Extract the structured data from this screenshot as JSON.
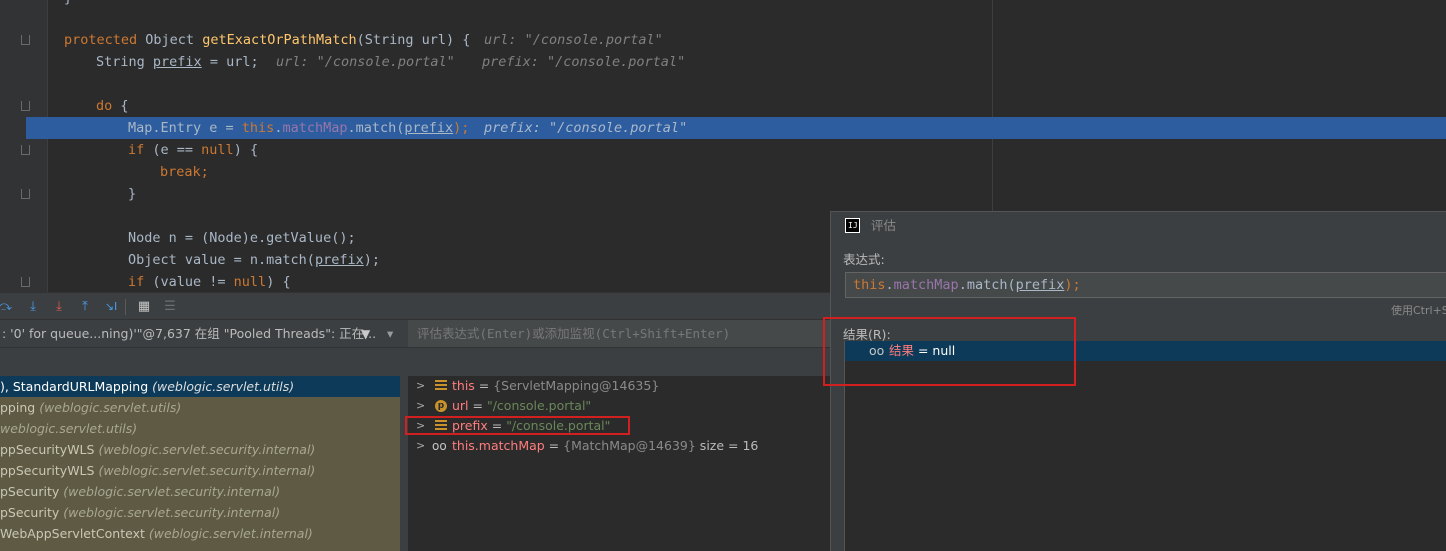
{
  "editor": {
    "line0": "}",
    "method_kw": "protected",
    "method_rest": " Object ",
    "method_name": "getExactOrPathMatch",
    "method_params": "(String url) {",
    "method_hint": "url: \"/console.portal\"",
    "prefix_type": "String ",
    "prefix_var": "prefix",
    "prefix_assign": " = url;",
    "prefix_hint1": "url: \"/console.portal\"",
    "prefix_hint2": "prefix: \"/console.portal\"",
    "do_kw": "do",
    "do_brace": " {",
    "exec_a": "Map.Entry e = ",
    "exec_this": "this",
    "exec_dot": ".",
    "exec_field": "matchMap",
    "exec_call": ".match(",
    "exec_arg": "prefix",
    "exec_end": ");",
    "exec_hint": "prefix: \"/console.portal\"",
    "if_kw": "if",
    "if_mid": " (e == ",
    "if_null": "null",
    "if_end": ") {",
    "break_kw": "break;",
    "close_brace": "}",
    "node_line": "Node n = (Node)e.getValue();",
    "obj_a": "Object value = n.match(",
    "obj_arg": "prefix",
    "obj_end": ");",
    "if2_kw": "if",
    "if2_mid": " (value != ",
    "if2_null": "null",
    "if2_end": ") {"
  },
  "debugger": {
    "toolbar": {
      "step_over": "⤼",
      "step_into": "⤓",
      "force_step_into": "⤓",
      "step_out": "⤒",
      "run_to_cursor": "↘I",
      "evaluate": "▦",
      "trace": "☰"
    },
    "thread_label": ": '0' for queue...ning)'\"@7,637 在组 \"Pooled Threads\": 正在...",
    "filter_icon": "▼",
    "dropdown_icon": "▾",
    "frames": [
      {
        "method": "), StandardURLMapping",
        "pkg": "(weblogic.servlet.utils)"
      },
      {
        "method": "pping",
        "pkg": "(weblogic.servlet.utils)"
      },
      {
        "method": "",
        "pkg": "weblogic.servlet.utils)"
      },
      {
        "method": "ppSecurityWLS",
        "pkg": "(weblogic.servlet.security.internal)"
      },
      {
        "method": "ppSecurityWLS",
        "pkg": "(weblogic.servlet.security.internal)"
      },
      {
        "method": "pSecurity",
        "pkg": "(weblogic.servlet.security.internal)"
      },
      {
        "method": "pSecurity",
        "pkg": "(weblogic.servlet.security.internal)"
      },
      {
        "method": "WebAppServletContext",
        "pkg": "(weblogic.servlet.internal)"
      }
    ],
    "watch_placeholder": "评估表达式(Enter)或添加监视(Ctrl+Shift+Enter)",
    "variables": [
      {
        "name": "this",
        "eq": " = ",
        "value": "{ServletMapping@14635}",
        "value_kind": "type",
        "extra": "",
        "icon": "field-icon"
      },
      {
        "name": "url",
        "eq": " = ",
        "value": "\"/console.portal\"",
        "value_kind": "string",
        "extra": "",
        "icon": "parameter-icon"
      },
      {
        "name": "prefix",
        "eq": " = ",
        "value": "\"/console.portal\"",
        "value_kind": "string",
        "extra": "",
        "icon": "field-icon"
      },
      {
        "name": "this.matchMap",
        "eq": " = ",
        "value": "{MatchMap@14639}",
        "value_kind": "type",
        "extra": "  size = 16",
        "icon": "watch-icon"
      }
    ]
  },
  "evaluate": {
    "title": "评估",
    "logo": "IJ",
    "expression_label": "表达式:",
    "expr_this": "this",
    "expr_dot": ".",
    "expr_field": "matchMap",
    "expr_call": ".match(",
    "expr_arg": "prefix",
    "expr_end": ");",
    "shortcut_hint": "使用Ctrl+S",
    "result_label": "结果(R):",
    "result_name": "结果",
    "result_value": " = null"
  },
  "colors": {
    "highlight_box": "#d21f1f",
    "execution_line": "#2d5d9e",
    "selection": "#0d3a58"
  }
}
